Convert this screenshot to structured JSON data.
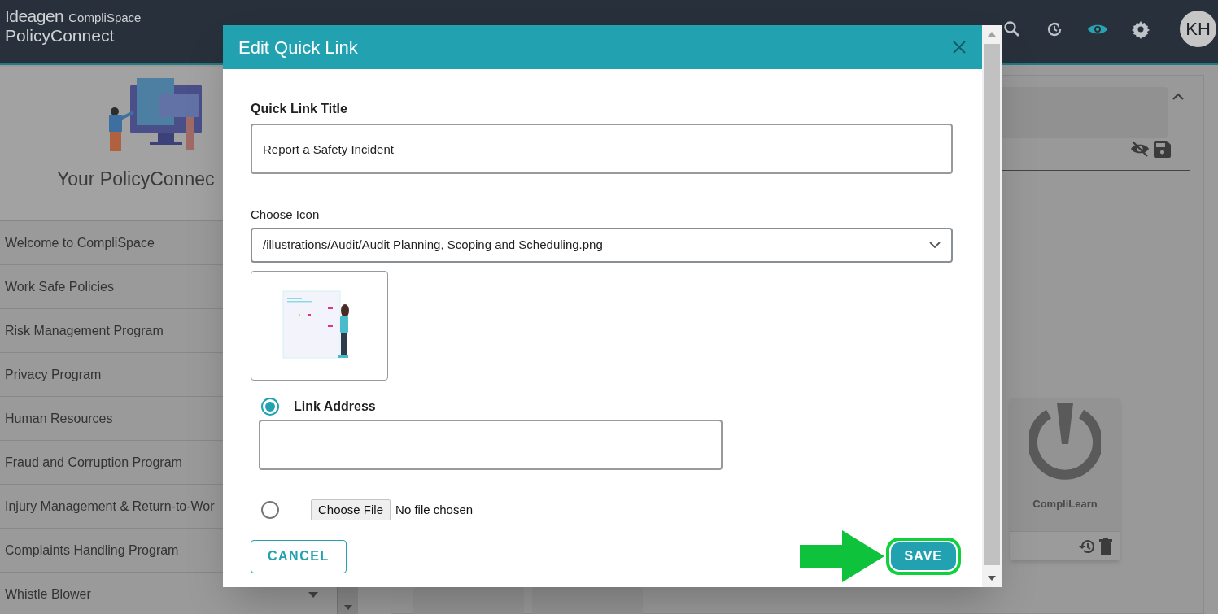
{
  "header": {
    "logo_brand": "Ideagen",
    "logo_sub": "CompliSpace",
    "logo_product": "PolicyConnect",
    "avatar": "KH"
  },
  "sidebar": {
    "banner_title": "Your PolicyConnec",
    "items": [
      {
        "label": "Welcome to CompliSpace"
      },
      {
        "label": "Work Safe Policies"
      },
      {
        "label": "Risk Management Program"
      },
      {
        "label": "Privacy Program"
      },
      {
        "label": "Human Resources"
      },
      {
        "label": "Fraud and Corruption Program"
      },
      {
        "label": "Injury Management & Return-to-Wor"
      },
      {
        "label": "Complaints Handling Program"
      },
      {
        "label": "Whistle Blower",
        "expandable": true
      }
    ]
  },
  "cards": [
    {
      "title": "CompliLearn"
    }
  ],
  "dialog": {
    "title": "Edit Quick Link",
    "title_field": {
      "label": "Quick Link Title",
      "value": "Report a Safety Incident"
    },
    "icon_select": {
      "label": "Choose Icon",
      "value": "/illustrations/Audit/Audit Planning, Scoping and Scheduling.png"
    },
    "options": [
      {
        "kind": "link",
        "label": "Link Address",
        "selected": true
      },
      {
        "kind": "file",
        "button": "Choose File",
        "status": "No file chosen",
        "selected": false
      }
    ],
    "buttons": [
      {
        "kind": "cancel",
        "label": "CANCEL",
        "highlighted": false
      },
      {
        "kind": "save",
        "label": "SAVE",
        "highlighted": true
      }
    ]
  }
}
